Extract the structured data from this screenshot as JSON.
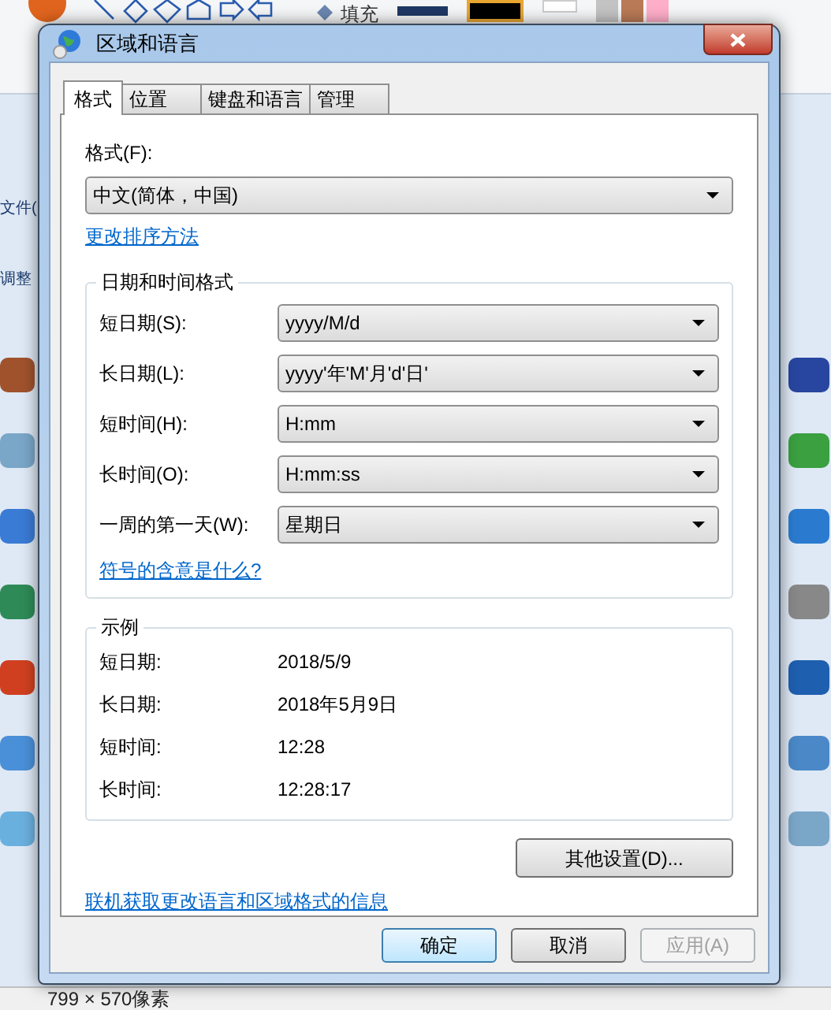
{
  "background": {
    "fill_label": "填充",
    "left_texts": [
      "文件(",
      "调整"
    ],
    "status_bar": "799 × 570像素"
  },
  "window": {
    "title": "区域和语言"
  },
  "tabs": [
    {
      "label": "格式",
      "selected": true
    },
    {
      "label": "位置",
      "selected": false
    },
    {
      "label": "键盘和语言",
      "selected": false
    },
    {
      "label": "管理",
      "selected": false
    }
  ],
  "format": {
    "label": "格式(F):",
    "value": "中文(简体，中国)"
  },
  "sort_link": "更改排序方法",
  "datetime_group": {
    "title": "日期和时间格式",
    "fields": [
      {
        "label": "短日期(S):",
        "value": "yyyy/M/d"
      },
      {
        "label": "长日期(L):",
        "value": "yyyy'年'M'月'd'日'"
      },
      {
        "label": "短时间(H):",
        "value": "H:mm"
      },
      {
        "label": "长时间(O):",
        "value": "H:mm:ss"
      },
      {
        "label": "一周的第一天(W):",
        "value": "星期日"
      }
    ],
    "link": "符号的含意是什么?"
  },
  "example_group": {
    "title": "示例",
    "rows": [
      {
        "label": "短日期:",
        "value": "2018/5/9"
      },
      {
        "label": "长日期:",
        "value": "2018年5月9日"
      },
      {
        "label": "短时间:",
        "value": "12:28"
      },
      {
        "label": "长时间:",
        "value": "12:28:17"
      }
    ]
  },
  "more_button": "其他设置(D)...",
  "online_link": "联机获取更改语言和区域格式的信息",
  "buttons": [
    {
      "label": "确定",
      "default": true,
      "disabled": false
    },
    {
      "label": "取消",
      "default": false,
      "disabled": false
    },
    {
      "label": "应用(A)",
      "default": false,
      "disabled": true
    }
  ]
}
